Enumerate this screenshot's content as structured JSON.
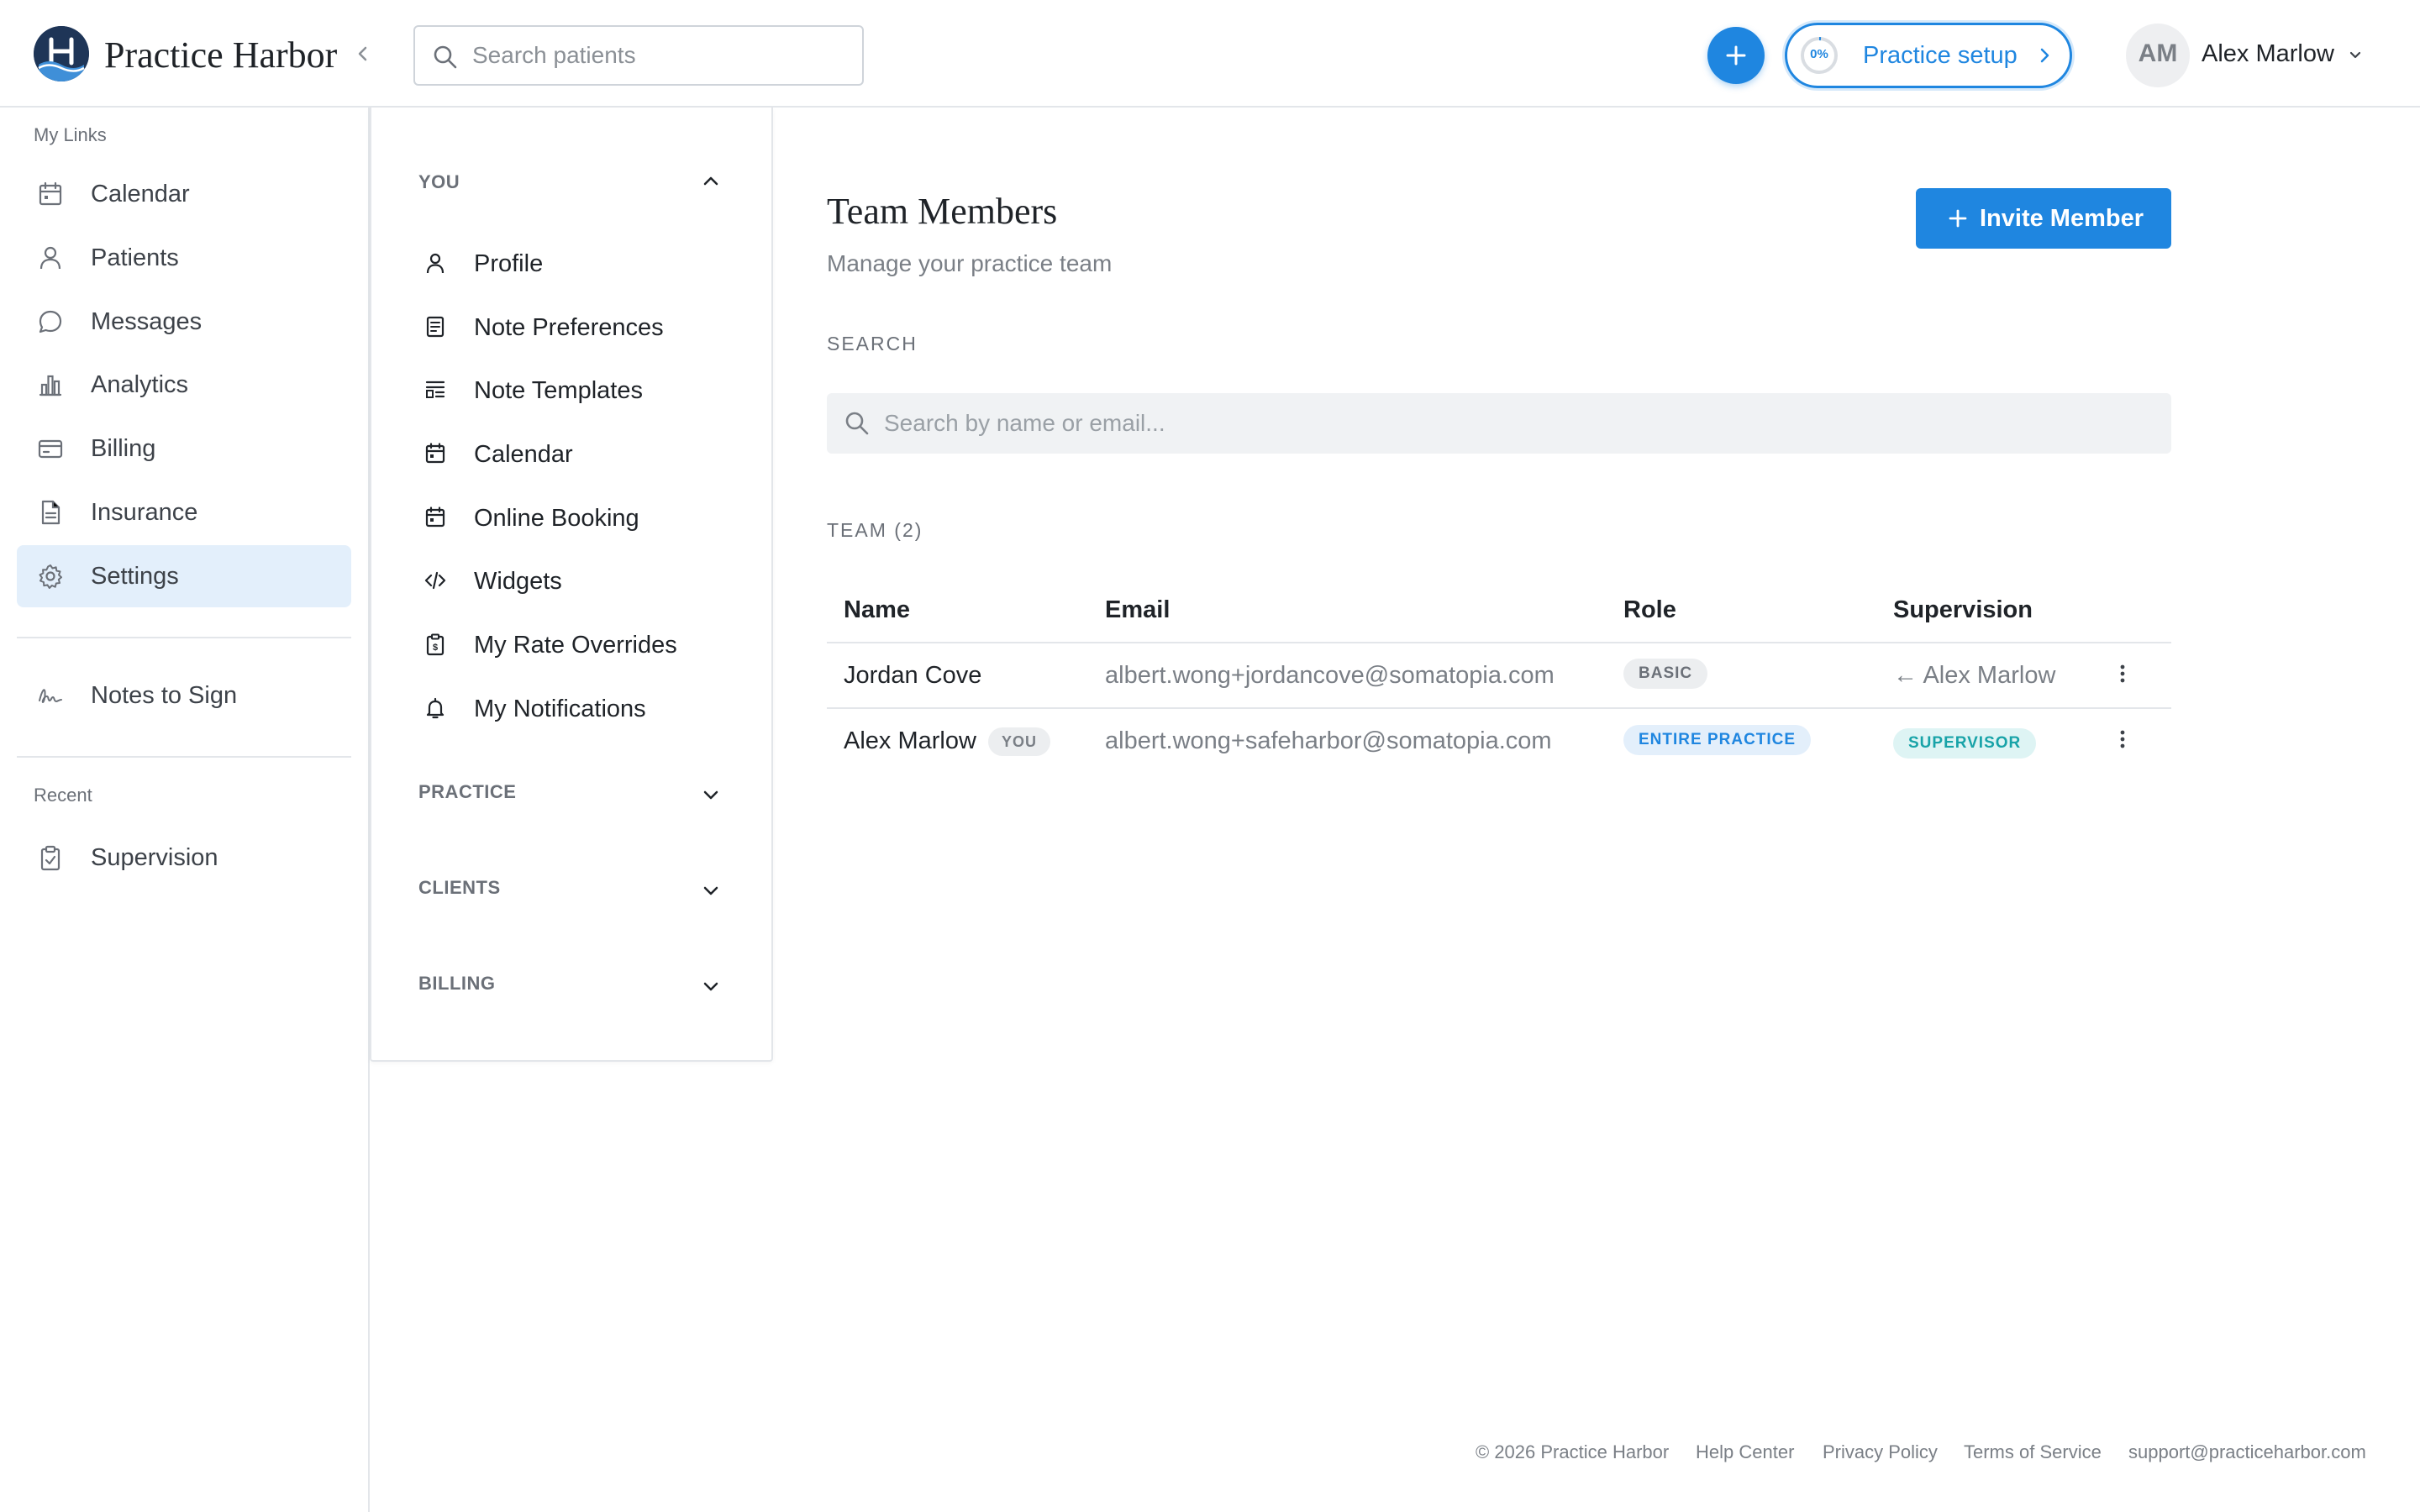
{
  "app": {
    "brand": "Practice Harbor"
  },
  "topbar": {
    "search_placeholder": "Search patients",
    "setup": {
      "progress_label": "0%",
      "progress": 0,
      "label": "Practice setup"
    },
    "user": {
      "initials": "AM",
      "name": "Alex Marlow"
    }
  },
  "sidebar": {
    "my_links_label": "My Links",
    "items": [
      {
        "label": "Calendar",
        "icon": "calendar-icon"
      },
      {
        "label": "Patients",
        "icon": "person-icon"
      },
      {
        "label": "Messages",
        "icon": "chat-bubble-icon"
      },
      {
        "label": "Analytics",
        "icon": "bar-chart-icon"
      },
      {
        "label": "Billing",
        "icon": "credit-card-icon"
      },
      {
        "label": "Insurance",
        "icon": "document-icon"
      },
      {
        "label": "Settings",
        "icon": "gear-icon",
        "active": true
      }
    ],
    "notes_to_sign": "Notes to Sign",
    "recent_label": "Recent",
    "recent_items": [
      {
        "label": "Supervision",
        "icon": "clipboard-check-icon"
      }
    ]
  },
  "settings_nav": {
    "you_label": "YOU",
    "you_items": [
      {
        "label": "Profile",
        "icon": "person-icon"
      },
      {
        "label": "Note Preferences",
        "icon": "note-icon"
      },
      {
        "label": "Note Templates",
        "icon": "template-icon"
      },
      {
        "label": "Calendar",
        "icon": "calendar-icon"
      },
      {
        "label": "Online Booking",
        "icon": "calendar-booking-icon"
      },
      {
        "label": "Widgets",
        "icon": "code-icon"
      },
      {
        "label": "My Rate Overrides",
        "icon": "rate-clipboard-icon"
      },
      {
        "label": "My Notifications",
        "icon": "bell-icon"
      }
    ],
    "groups": [
      "PRACTICE",
      "CLIENTS",
      "BILLING"
    ]
  },
  "main": {
    "title": "Team Members",
    "subtitle": "Manage your practice team",
    "invite_label": "Invite Member",
    "search_label": "SEARCH",
    "search_placeholder": "Search by name or email...",
    "team_label": "TEAM (2)",
    "columns": {
      "name": "Name",
      "email": "Email",
      "role": "Role",
      "supervision": "Supervision"
    },
    "rows": [
      {
        "name": "Jordan Cove",
        "email": "albert.wong+jordancove@somatopia.com",
        "role": "BASIC",
        "supervision": "← Alex Marlow"
      },
      {
        "name": "Alex Marlow",
        "you_badge": "YOU",
        "email": "albert.wong+safeharbor@somatopia.com",
        "role": "ENTIRE PRACTICE",
        "supervision_badge": "SUPERVISOR"
      }
    ]
  },
  "footer": {
    "copyright": "© 2026 Practice Harbor",
    "links": [
      "Help Center",
      "Privacy Policy",
      "Terms of Service",
      "support@practiceharbor.com"
    ]
  },
  "colors": {
    "accent": "#1f86e0",
    "active_bg": "#e3effb",
    "supervisor": "#18a3a8"
  }
}
